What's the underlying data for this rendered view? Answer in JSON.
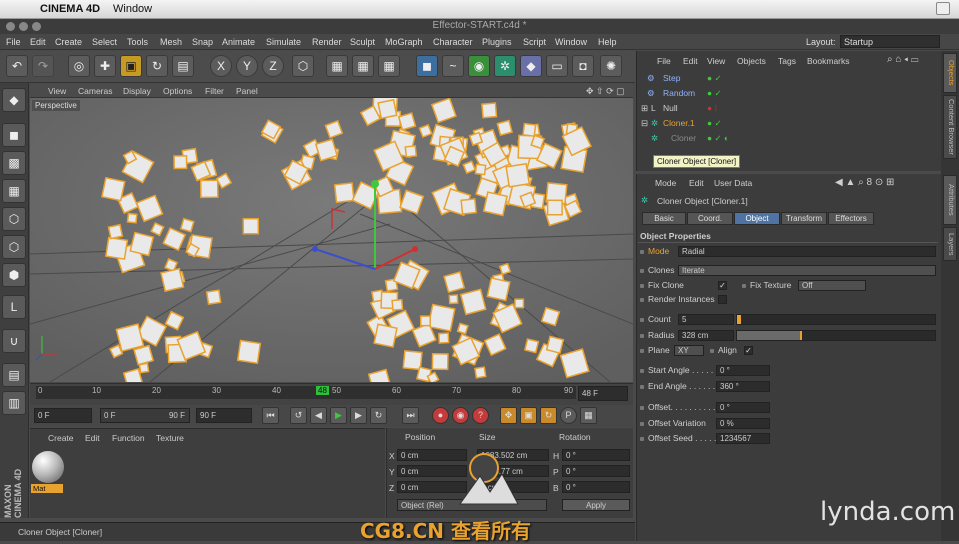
{
  "mac": {
    "apple": "",
    "app": "CINEMA 4D",
    "window": "Window"
  },
  "window": {
    "title": "Effector-START.c4d *"
  },
  "menu": {
    "items": [
      "File",
      "Edit",
      "Create",
      "Select",
      "Tools",
      "Mesh",
      "Snap",
      "Animate",
      "Simulate",
      "Render",
      "Sculpt",
      "MoGraph",
      "Character",
      "Plugins",
      "Script",
      "Window",
      "Help"
    ],
    "layout_label": "Layout:",
    "layout_value": "Startup"
  },
  "viewport": {
    "menu": [
      "View",
      "Cameras",
      "Display",
      "Options",
      "Filter",
      "Panel"
    ],
    "label": "Perspective"
  },
  "timeline": {
    "ticks": [
      "0",
      "10",
      "20",
      "30",
      "40",
      "48",
      "50",
      "60",
      "70",
      "80",
      "90"
    ],
    "end_frame": "48 F"
  },
  "playback": {
    "current": "0 F",
    "start": "0 F",
    "range_end": "90 F",
    "end": "90 F"
  },
  "materials": {
    "menu": [
      "Create",
      "Edit",
      "Function",
      "Texture"
    ],
    "mat_name": "Mat"
  },
  "coords": {
    "headers": [
      "Position",
      "Size",
      "Rotation"
    ],
    "rows": [
      {
        "axis": "X",
        "pos": "0 cm",
        "size": "1083.502 cm",
        "rot_axis": "H",
        "rot": "0 °"
      },
      {
        "axis": "Y",
        "pos": "0 cm",
        "size": "1083.77 cm",
        "rot_axis": "P",
        "rot": "0 °"
      },
      {
        "axis": "Z",
        "pos": "0 cm",
        "size": "0 cm",
        "rot_axis": "B",
        "rot": "0 °"
      }
    ],
    "mode": "Object (Rel)",
    "apply": "Apply"
  },
  "status": {
    "text": "Cloner Object [Cloner]"
  },
  "objects": {
    "menu": [
      "File",
      "Edit",
      "View",
      "Objects",
      "Tags",
      "Bookmarks"
    ],
    "items": [
      {
        "name": "Step",
        "color": "#8fb3ff"
      },
      {
        "name": "Random",
        "color": "#8fb3ff"
      },
      {
        "name": "Null",
        "color": "#dddddd"
      },
      {
        "name": "Cloner.1",
        "color": "#e8a230"
      },
      {
        "name": "Cloner",
        "color": "#8a8a8a"
      }
    ],
    "tooltip": "Cloner Object [Cloner]"
  },
  "attributes": {
    "menu": [
      "Mode",
      "Edit",
      "User Data"
    ],
    "object_title": "Cloner Object [Cloner.1]",
    "tabs": [
      "Basic",
      "Coord.",
      "Object",
      "Transform",
      "Effectors"
    ],
    "section": "Object Properties",
    "mode_label": "Mode",
    "mode_value": "Radial",
    "clones_label": "Clones",
    "clones_value": "Iterate",
    "fix_clone_label": "Fix Clone",
    "fix_texture_label": "Fix Texture",
    "fix_texture_value": "Off",
    "render_instances_label": "Render Instances",
    "count_label": "Count",
    "count_value": "5",
    "count_fraction": 0.02,
    "radius_label": "Radius",
    "radius_value": "328 cm",
    "radius_fraction": 0.33,
    "plane_label": "Plane",
    "plane_value": "XY",
    "align_label": "Align",
    "start_angle_label": "Start Angle . . . . . .",
    "start_angle_value": "0 °",
    "end_angle_label": "End Angle . . . . . . .",
    "end_angle_value": "360 °",
    "offset_label": "Offset. . . . . . . . . .",
    "offset_value": "0 °",
    "offset_variation_label": "Offset Variation",
    "offset_variation_value": "0 %",
    "offset_seed_label": "Offset Seed . . . . .",
    "offset_seed_value": "1234567"
  },
  "side_tabs": [
    "Objects",
    "Content Browser",
    "Attributes",
    "Layers"
  ],
  "watermark": {
    "brand": "lynda.com",
    "left": "CG8.CN 查看所有",
    "maxon": "MAXON CINEMA 4D"
  }
}
